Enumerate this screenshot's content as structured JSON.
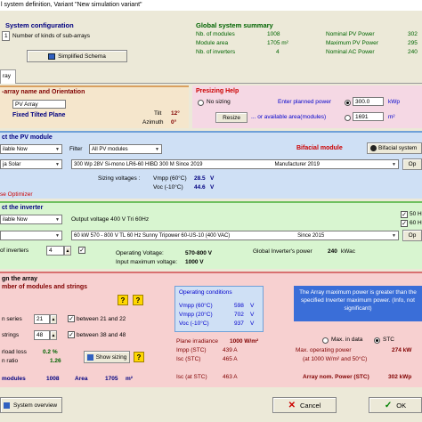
{
  "window": {
    "title": "l system definition, Variant  \"New simulation variant\""
  },
  "system_config": {
    "title": "System configuration",
    "subarrays_count": "1",
    "subarrays_label": "Number of kinds of sub-arrays",
    "schema_button": "Simplified Schema"
  },
  "summary": {
    "title": "Global system summary",
    "rows": [
      {
        "label": "Nb. of modules",
        "value": "1008",
        "label2": "Nominal PV Power",
        "value2": "302"
      },
      {
        "label": "Module area",
        "value": "1705 m²",
        "label2": "Maximum PV Power",
        "value2": "295"
      },
      {
        "label": "Nb. of inverters",
        "value": "4",
        "label2": "Nominal AC Power",
        "value2": "240"
      }
    ]
  },
  "tab": {
    "label": "ray"
  },
  "orientation": {
    "title": "-array name and Orientation",
    "name_value": "PV Array",
    "plane_label": "Fixed Tilted Plane",
    "tilt_label": "Tilt",
    "tilt_value": "12°",
    "azimuth_label": "Azimuth",
    "azimuth_value": "0°"
  },
  "presizing": {
    "title": "Presizing Help",
    "no_sizing_label": "No sizing",
    "enter_power_label": "Enter planned power",
    "power_value": "300.0",
    "power_unit": "kWp",
    "resize_button": "Resize",
    "area_label": "... or available area(modules)",
    "area_value": "1691",
    "area_unit": "m²"
  },
  "pv_module": {
    "title": "ct the PV module",
    "available_select": "ilable Now",
    "filter_label": "Filter",
    "filter_select": "All PV modules",
    "bifacial_label": "Bifacial module",
    "bifacial_button": "Bifacial system",
    "manufacturer_select": "ja Solar",
    "module_select": "300 Wp 28V    Si-mono    LR6-60 HIBD 300 M         Since 2019",
    "manufacturer_label": "Manufacturer 2019",
    "open_button": "Op",
    "sizing_voltages_label": "Sizing voltages :",
    "vmpp_label": "Vmpp (60°C)",
    "vmpp_value": "28.5",
    "vmpp_unit": "V",
    "voc_label": "Voc (-10°C)",
    "voc_value": "44.6",
    "voc_unit": "V",
    "optimizer_label": "se Optimizer"
  },
  "inverter": {
    "title": "ct the inverter",
    "available_select": "ilable Now",
    "output_label": "Output voltage 400 V Tri 60Hz",
    "opt1": "50 H",
    "opt2": "60 H",
    "manufacturer_select": "",
    "model_select": "60 kW     570 - 800 V    TL        60 Hz     Sunny Tripower 60-US-10 (400 VAC)",
    "since_label": "Since 2015",
    "open_button": "Op",
    "count_label": "of inverters",
    "count_value": "4",
    "op_voltage_label": "Operating Voltage:",
    "op_voltage_value": "570-800 V",
    "input_max_label": "Input maximum voltage:",
    "input_max_value": "1000 V",
    "global_power_label": "Global Inverter's power",
    "global_power_value": "240",
    "global_power_unit": "kWac"
  },
  "design": {
    "title": "gn the array",
    "subtitle": "mber of modules and strings",
    "series_label": "n series",
    "series_value": "21",
    "series_range": "between 21 and 22",
    "strings_label": "strings",
    "strings_value": "48",
    "strings_range": "between 38 and 48",
    "overload_label": "rload loss",
    "overload_value": "0.2 %",
    "ratio_label": "n ratio",
    "ratio_value": "1.26",
    "show_sizing_button": "Show sizing",
    "modules_label": "modules",
    "modules_value": "1008",
    "area_label": "Area",
    "area_value": "1705",
    "area_unit": "m²"
  },
  "operating": {
    "title": "Operating conditions",
    "rows": [
      {
        "label": "Vmpp (60°C)",
        "value": "598",
        "unit": "V"
      },
      {
        "label": "Vmpp (20°C)",
        "value": "702",
        "unit": "V"
      },
      {
        "label": "Voc (-10°C)",
        "value": "937",
        "unit": "V"
      }
    ],
    "irradiance_label": "Plane irradiance",
    "irradiance_value": "1000 W/m²",
    "impp_label": "Impp (STC)",
    "impp_value": "439 A",
    "isc_label": "Isc (STC)",
    "isc_value": "465 A",
    "isc_at_label": "Isc (at STC)",
    "isc_at_value": "463 A"
  },
  "array_power": {
    "warning": "The Array maximum power is greater than the specified Inverter maximum power. (Info, not significant)",
    "max_data_label": "Max. in data",
    "stc_label": "STC",
    "max_power_label": "Max. operating power",
    "max_power_sub": "(at 1000 W/m² and 50°C)",
    "max_power_value": "274 kW",
    "nom_power_label": "Array nom. Power (STC)",
    "nom_power_value": "302 kWp"
  },
  "footer": {
    "overview_button": "System overview",
    "cancel_button": "Cancel",
    "ok_button": "OK"
  },
  "colors": {
    "summary_green": "#006400",
    "section_blue": "#cfe0f5",
    "section_green": "#d8f5d0",
    "section_pink": "#f5d8e4",
    "section_red": "#f7d0d0"
  }
}
